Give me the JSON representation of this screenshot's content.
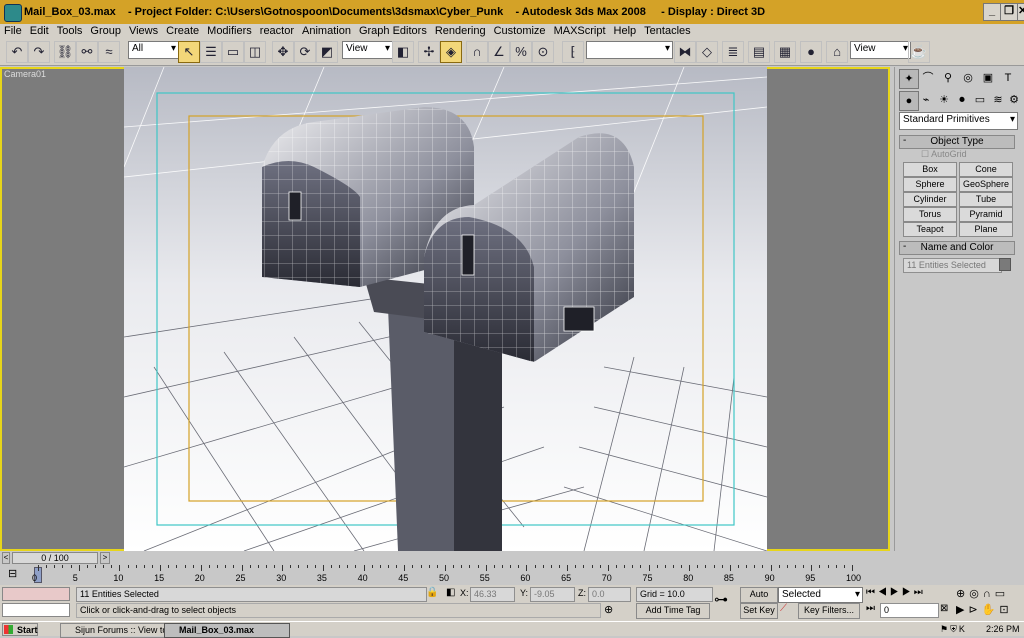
{
  "window": {
    "title": "Mail_Box_03.max    - Project Folder: C:\\Users\\Gotnospoon\\Documents\\3dsmax\\Cyber_Punk    - Autodesk 3ds Max 2008     - Display : Direct 3D",
    "controls": [
      "_",
      "❐",
      "✕"
    ]
  },
  "menu": [
    "File",
    "Edit",
    "Tools",
    "Group",
    "Views",
    "Create",
    "Modifiers",
    "reactor",
    "Animation",
    "Graph Editors",
    "Rendering",
    "Customize",
    "MAXScript",
    "Help",
    "Tentacles"
  ],
  "toolbar": {
    "selection_filter": "All",
    "reference_coord": "View",
    "named_selection": "",
    "render_view": "View"
  },
  "viewport": {
    "label": "Camera01"
  },
  "command_panel": {
    "category": "Standard Primitives",
    "object_type_title": "Object Type",
    "autogrid": "AutoGrid",
    "objects": [
      "Box",
      "Cone",
      "Sphere",
      "GeoSphere",
      "Cylinder",
      "Tube",
      "Torus",
      "Pyramid",
      "Teapot",
      "Plane"
    ],
    "name_color_title": "Name and Color",
    "name_value": "11 Entities Selected",
    "color_swatch": "#7a7a7a"
  },
  "timeline": {
    "frame_readout": "0 / 100",
    "ticks": [
      "0",
      "5",
      "10",
      "15",
      "20",
      "25",
      "30",
      "35",
      "40",
      "45",
      "50",
      "55",
      "60",
      "65",
      "70",
      "75",
      "80",
      "85",
      "90",
      "95",
      "100"
    ]
  },
  "status": {
    "selection": "11 Entities Selected",
    "prompt": "Click or click-and-drag to select objects",
    "x_label": "X:",
    "x_value": "46.33",
    "y_label": "Y:",
    "y_value": "-9.05",
    "z_label": "Z:",
    "z_value": "0.0",
    "grid": "Grid = 10.0",
    "add_time_tag": "Add Time Tag",
    "auto_key": "Auto Key",
    "set_key": "Set Key",
    "key_mode": "Selected",
    "key_filters": "Key Filters...",
    "current_frame": "0"
  },
  "taskbar": {
    "start": "Start",
    "tasks": [
      "Sijun Forums :: View topic...",
      "Mail_Box_03.max"
    ],
    "clock": "2:26 PM"
  }
}
